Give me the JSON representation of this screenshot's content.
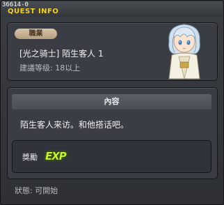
{
  "window": {
    "quest_id": "36614-0",
    "title": "QUEST INFO"
  },
  "job": {
    "badge_label": "職業",
    "job_name": "[光之骑士] 陌生客人 1",
    "recommended_level": "建議等级: 18以上"
  },
  "content": {
    "header": "內容",
    "text": "陌生客人来访。和他搭话吧。"
  },
  "reward": {
    "label": "獎勵",
    "exp_badge": "EXP"
  },
  "status": {
    "text": "狀態: 可開始"
  },
  "colors": {
    "title": "#f3d21a",
    "badge": "#c9b493",
    "exp": "#c8f22a"
  },
  "icons": {
    "portrait": "npc-portrait",
    "exp": "exp-icon"
  }
}
